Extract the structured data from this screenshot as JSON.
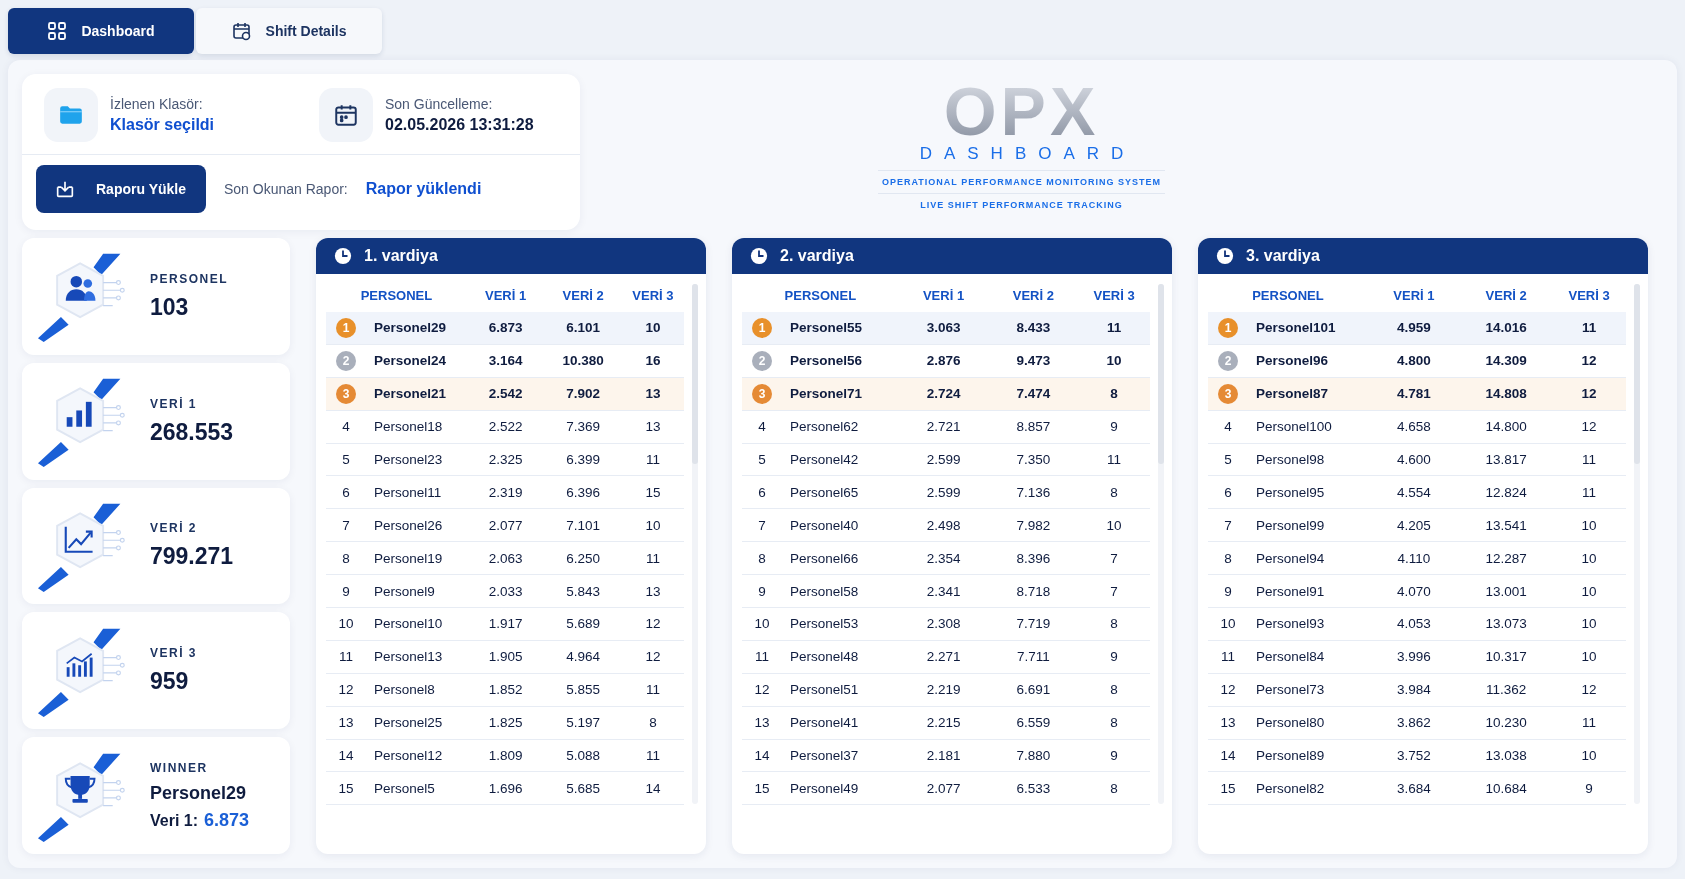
{
  "tabs": [
    {
      "label": "Dashboard",
      "kind": "grid",
      "selected": true
    },
    {
      "label": "Shift Details",
      "kind": "calendar",
      "selected": false
    }
  ],
  "info": {
    "folder_label": "İzlenen Klasör:",
    "folder_value": "Klasör seçildi",
    "update_label": "Son Güncelleme:",
    "update_value": "02.05.2026 13:31:28",
    "upload_button": "Raporu Yükle",
    "report_label": "Son Okunan Rapor:",
    "report_value": "Rapor yüklendi"
  },
  "logo": {
    "mark": "OPX",
    "word": "DASHBOARD",
    "subtitle": "OPERATIONAL PERFORMANCE MONITORING SYSTEM",
    "tagline": "LIVE SHIFT PERFORMANCE TRACKING"
  },
  "stats": [
    {
      "kind": "people",
      "label": "PERSONEL",
      "value": "103"
    },
    {
      "kind": "bars",
      "label": "VERİ 1",
      "value": "268.553"
    },
    {
      "kind": "trend",
      "label": "VERİ 2",
      "value": "799.271"
    },
    {
      "kind": "combo",
      "label": "VERİ 3",
      "value": "959"
    },
    {
      "kind": "trophy",
      "label": "WINNER",
      "value": "Personel29",
      "detail_label": "Veri 1:",
      "detail_value": "6.873"
    }
  ],
  "shifts": [
    {
      "title": "1. vardiya",
      "columns": [
        "PERSONEL",
        "VERİ 1",
        "VERİ 2",
        "VERİ 3"
      ],
      "rows": [
        {
          "rank": "1",
          "kind": "gold",
          "name": "Personel29",
          "v1": "6.873",
          "v2": "6.101",
          "v3": "10"
        },
        {
          "rank": "2",
          "kind": "silver",
          "name": "Personel24",
          "v1": "3.164",
          "v2": "10.380",
          "v3": "16"
        },
        {
          "rank": "3",
          "kind": "bronze",
          "name": "Personel21",
          "v1": "2.542",
          "v2": "7.902",
          "v3": "13"
        },
        {
          "rank": "4",
          "name": "Personel18",
          "v1": "2.522",
          "v2": "7.369",
          "v3": "13"
        },
        {
          "rank": "5",
          "name": "Personel23",
          "v1": "2.325",
          "v2": "6.399",
          "v3": "11"
        },
        {
          "rank": "6",
          "name": "Personel11",
          "v1": "2.319",
          "v2": "6.396",
          "v3": "15"
        },
        {
          "rank": "7",
          "name": "Personel26",
          "v1": "2.077",
          "v2": "7.101",
          "v3": "10"
        },
        {
          "rank": "8",
          "name": "Personel19",
          "v1": "2.063",
          "v2": "6.250",
          "v3": "11"
        },
        {
          "rank": "9",
          "name": "Personel9",
          "v1": "2.033",
          "v2": "5.843",
          "v3": "13"
        },
        {
          "rank": "10",
          "name": "Personel10",
          "v1": "1.917",
          "v2": "5.689",
          "v3": "12"
        },
        {
          "rank": "11",
          "name": "Personel13",
          "v1": "1.905",
          "v2": "4.964",
          "v3": "12"
        },
        {
          "rank": "12",
          "name": "Personel8",
          "v1": "1.852",
          "v2": "5.855",
          "v3": "11"
        },
        {
          "rank": "13",
          "name": "Personel25",
          "v1": "1.825",
          "v2": "5.197",
          "v3": "8"
        },
        {
          "rank": "14",
          "name": "Personel12",
          "v1": "1.809",
          "v2": "5.088",
          "v3": "11"
        },
        {
          "rank": "15",
          "name": "Personel5",
          "v1": "1.696",
          "v2": "5.685",
          "v3": "14"
        }
      ]
    },
    {
      "title": "2. vardiya",
      "columns": [
        "PERSONEL",
        "VERİ 1",
        "VERİ 2",
        "VERİ 3"
      ],
      "rows": [
        {
          "rank": "1",
          "kind": "gold",
          "name": "Personel55",
          "v1": "3.063",
          "v2": "8.433",
          "v3": "11"
        },
        {
          "rank": "2",
          "kind": "silver",
          "name": "Personel56",
          "v1": "2.876",
          "v2": "9.473",
          "v3": "10"
        },
        {
          "rank": "3",
          "kind": "bronze",
          "name": "Personel71",
          "v1": "2.724",
          "v2": "7.474",
          "v3": "8"
        },
        {
          "rank": "4",
          "name": "Personel62",
          "v1": "2.721",
          "v2": "8.857",
          "v3": "9"
        },
        {
          "rank": "5",
          "name": "Personel42",
          "v1": "2.599",
          "v2": "7.350",
          "v3": "11"
        },
        {
          "rank": "6",
          "name": "Personel65",
          "v1": "2.599",
          "v2": "7.136",
          "v3": "8"
        },
        {
          "rank": "7",
          "name": "Personel40",
          "v1": "2.498",
          "v2": "7.982",
          "v3": "10"
        },
        {
          "rank": "8",
          "name": "Personel66",
          "v1": "2.354",
          "v2": "8.396",
          "v3": "7"
        },
        {
          "rank": "9",
          "name": "Personel58",
          "v1": "2.341",
          "v2": "8.718",
          "v3": "7"
        },
        {
          "rank": "10",
          "name": "Personel53",
          "v1": "2.308",
          "v2": "7.719",
          "v3": "8"
        },
        {
          "rank": "11",
          "name": "Personel48",
          "v1": "2.271",
          "v2": "7.711",
          "v3": "9"
        },
        {
          "rank": "12",
          "name": "Personel51",
          "v1": "2.219",
          "v2": "6.691",
          "v3": "8"
        },
        {
          "rank": "13",
          "name": "Personel41",
          "v1": "2.215",
          "v2": "6.559",
          "v3": "8"
        },
        {
          "rank": "14",
          "name": "Personel37",
          "v1": "2.181",
          "v2": "7.880",
          "v3": "9"
        },
        {
          "rank": "15",
          "name": "Personel49",
          "v1": "2.077",
          "v2": "6.533",
          "v3": "8"
        }
      ]
    },
    {
      "title": "3. vardiya",
      "columns": [
        "PERSONEL",
        "VERİ 1",
        "VERİ 2",
        "VERİ 3"
      ],
      "rows": [
        {
          "rank": "1",
          "kind": "gold",
          "name": "Personel101",
          "v1": "4.959",
          "v2": "14.016",
          "v3": "11"
        },
        {
          "rank": "2",
          "kind": "silver",
          "name": "Personel96",
          "v1": "4.800",
          "v2": "14.309",
          "v3": "12"
        },
        {
          "rank": "3",
          "kind": "bronze",
          "name": "Personel87",
          "v1": "4.781",
          "v2": "14.808",
          "v3": "12"
        },
        {
          "rank": "4",
          "name": "Personel100",
          "v1": "4.658",
          "v2": "14.800",
          "v3": "12"
        },
        {
          "rank": "5",
          "name": "Personel98",
          "v1": "4.600",
          "v2": "13.817",
          "v3": "11"
        },
        {
          "rank": "6",
          "name": "Personel95",
          "v1": "4.554",
          "v2": "12.824",
          "v3": "11"
        },
        {
          "rank": "7",
          "name": "Personel99",
          "v1": "4.205",
          "v2": "13.541",
          "v3": "10"
        },
        {
          "rank": "8",
          "name": "Personel94",
          "v1": "4.110",
          "v2": "12.287",
          "v3": "10"
        },
        {
          "rank": "9",
          "name": "Personel91",
          "v1": "4.070",
          "v2": "13.001",
          "v3": "10"
        },
        {
          "rank": "10",
          "name": "Personel93",
          "v1": "4.053",
          "v2": "13.073",
          "v3": "10"
        },
        {
          "rank": "11",
          "name": "Personel84",
          "v1": "3.996",
          "v2": "10.317",
          "v3": "10"
        },
        {
          "rank": "12",
          "name": "Personel73",
          "v1": "3.984",
          "v2": "11.362",
          "v3": "12"
        },
        {
          "rank": "13",
          "name": "Personel80",
          "v1": "3.862",
          "v2": "10.230",
          "v3": "11"
        },
        {
          "rank": "14",
          "name": "Personel89",
          "v1": "3.752",
          "v2": "13.038",
          "v3": "10"
        },
        {
          "rank": "15",
          "name": "Personel82",
          "v1": "3.684",
          "v2": "10.684",
          "v3": "9"
        }
      ]
    }
  ]
}
